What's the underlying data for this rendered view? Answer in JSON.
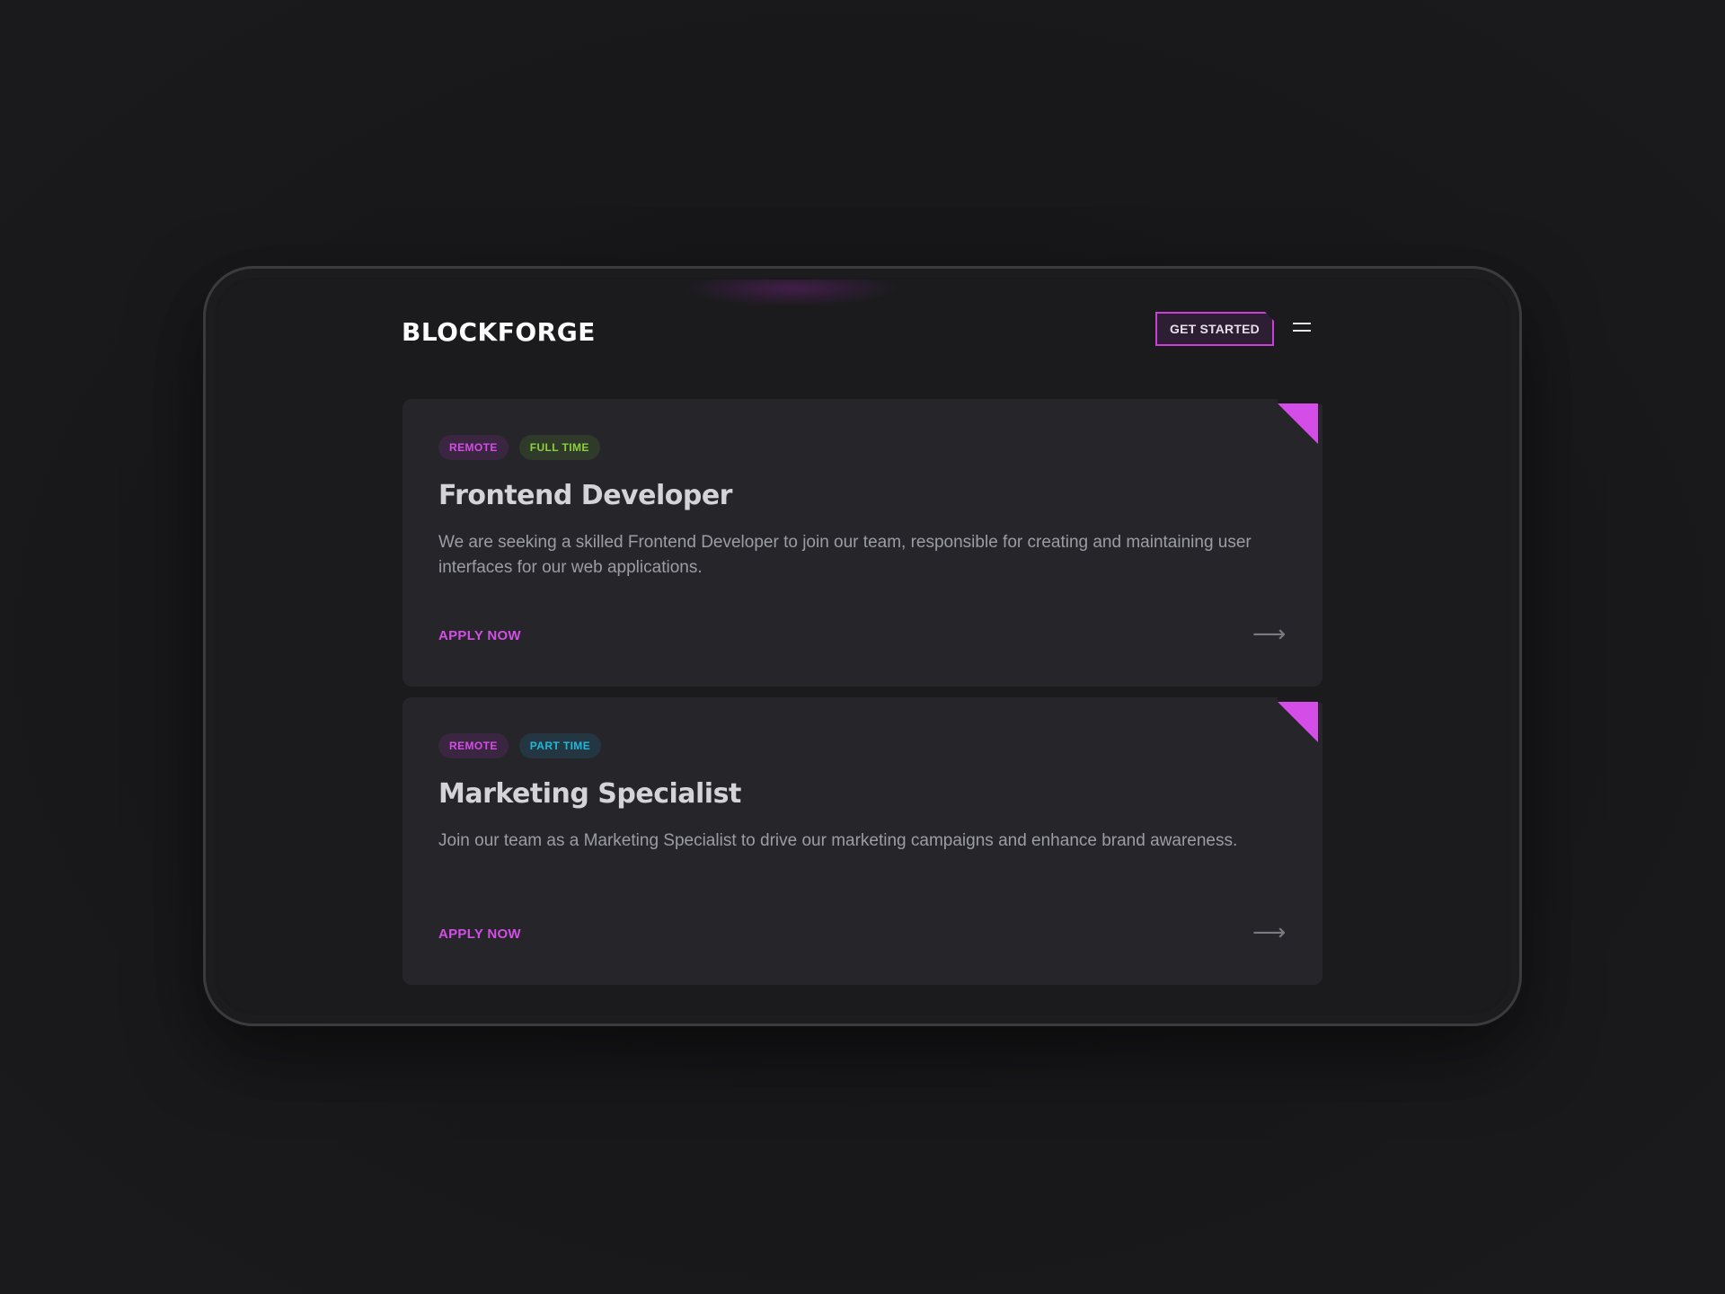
{
  "header": {
    "logo": "BLOCKFORGE",
    "cta_label": "GET STARTED",
    "menu_icon": "hamburger-icon"
  },
  "jobs": [
    {
      "tags": [
        "REMOTE",
        "FULL TIME"
      ],
      "title": "Frontend Developer",
      "description": "We are seeking a skilled Frontend Developer to join our team, responsible for creating and maintaining user interfaces for our web applications.",
      "apply_label": "APPLY NOW",
      "arrow_icon": "arrow-right-icon"
    },
    {
      "tags": [
        "REMOTE",
        "PART TIME"
      ],
      "title": "Marketing Specialist",
      "description": "Join our team as a Marketing Specialist to drive our marketing campaigns and enhance brand awareness.",
      "apply_label": "APPLY NOW",
      "arrow_icon": "arrow-right-icon"
    }
  ],
  "colors": {
    "accent": "#d44de6",
    "full_time": "#8bd13b",
    "part_time": "#20b8d8",
    "card_bg": "#26262a",
    "page_bg": "#1b1b1e"
  }
}
